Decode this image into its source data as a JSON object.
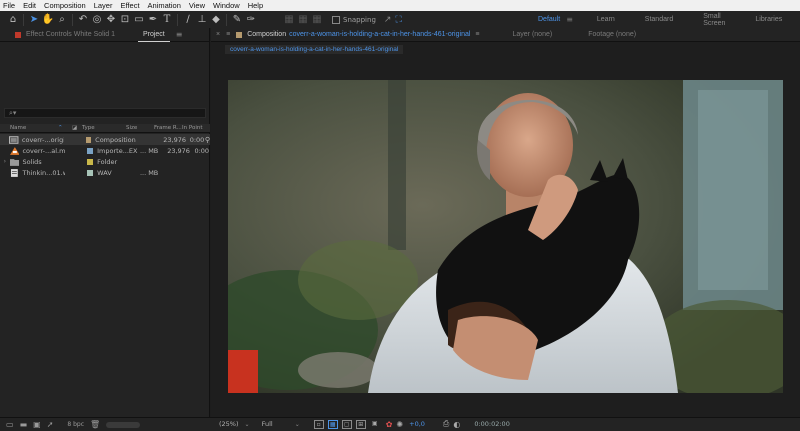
{
  "menu": [
    "File",
    "Edit",
    "Composition",
    "Layer",
    "Effect",
    "Animation",
    "View",
    "Window",
    "Help"
  ],
  "toolbar": {
    "tools": [
      "home-icon",
      "selection-arrow-icon",
      "hand-icon",
      "zoom-icon",
      "rotate-icon",
      "camera-orbit-icon",
      "pan-icon",
      "rectangle-icon",
      "pen-icon",
      "type-icon",
      "brush-icon",
      "clone-stamp-icon",
      "eraser-icon",
      "roto-brush-icon",
      "puppet-pin-icon"
    ],
    "snapping_label": "Snapping",
    "workspaces": [
      "Default",
      "Learn",
      "Standard",
      "Small Screen",
      "Libraries"
    ],
    "active_workspace": "Default"
  },
  "left_panel": {
    "effect_controls_tab": "Effect Controls White Solid 1",
    "project_tab": "Project",
    "search_placeholder": "⌕▾",
    "columns": {
      "name": "Name",
      "type": "Type",
      "size": "Size",
      "frame_rate": "Frame R...",
      "in_point": "In Point"
    },
    "items": [
      {
        "name": "coverr-...original",
        "type": "Composition",
        "size": "",
        "frame_rate": "23,976",
        "in_point": "0:00",
        "icon": "composition-icon",
        "label_color": "#b59a6e"
      },
      {
        "name": "coverr-...al.mp4",
        "type": "Importe...EX",
        "size": "... MB",
        "frame_rate": "23,976",
        "in_point": "0:00",
        "icon": "video-file-icon",
        "label_color": "#7aa2c4"
      },
      {
        "name": "Solids",
        "type": "Folder",
        "size": "",
        "frame_rate": "",
        "in_point": "",
        "icon": "folder-icon",
        "label_color": "#c9b84a"
      },
      {
        "name": "Thinkin...01.wav",
        "type": "WAV",
        "size": "... MB",
        "frame_rate": "",
        "in_point": "",
        "icon": "audio-file-icon",
        "label_color": "#a8c4b8"
      }
    ],
    "bpc": "8 bpc"
  },
  "composition_panel": {
    "tab_prefix": "Composition",
    "comp_name": "coverr-a-woman-is-holding-a-cat-in-her-hands-461-original",
    "layer_tab": "Layer (none)",
    "footage_tab": "Footage (none)",
    "breadcrumb": "coverr-a-woman-is-holding-a-cat-in-her-hands-461-original",
    "zoom": "(25%)",
    "resolution": "Full",
    "exposure": "+0,0",
    "timecode": "0:00:02:00"
  }
}
